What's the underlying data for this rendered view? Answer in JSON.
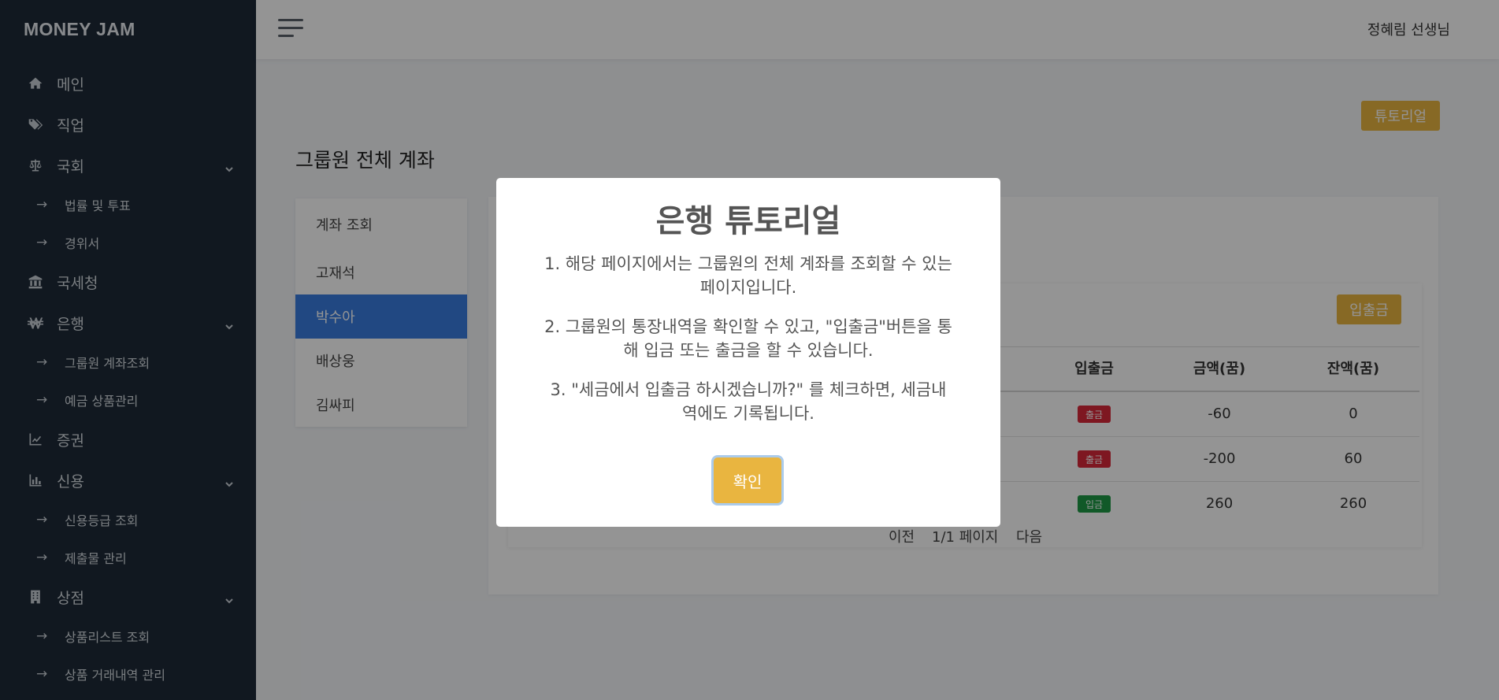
{
  "brand": "MONEY JAM",
  "user": {
    "name": "정혜림 선생님"
  },
  "sidebar": {
    "main": "메인",
    "job": "직업",
    "assembly": "국회",
    "law_vote": "법률 및 투표",
    "statement": "경위서",
    "tax": "국세청",
    "bank": "은행",
    "group_accounts": "그룹원 계좌조회",
    "deposit_products": "예금 상품관리",
    "securities": "증권",
    "credit": "신용",
    "credit_rating": "신용등급 조회",
    "submission": "제출물 관리",
    "store": "상점",
    "product_list": "상품리스트 조회",
    "product_history": "상품 거래내역 관리",
    "arrow": "→"
  },
  "main": {
    "tutorial_button": "튜토리얼",
    "page_title": "그룹원 전체 계좌",
    "members": [
      "계좌 조회",
      "고재석",
      "박수아",
      "배상웅",
      "김싸피"
    ],
    "io_button": "입출금",
    "table": {
      "headers": [
        "입출금",
        "금액(꿈)",
        "잔액(꿈)"
      ],
      "rows": [
        {
          "type": "출금",
          "amount": "-60",
          "balance": "0"
        },
        {
          "type": "출금",
          "amount": "-200",
          "balance": "60"
        },
        {
          "type": "입금",
          "amount": "260",
          "balance": "260"
        }
      ]
    },
    "pager": {
      "prev": "이전",
      "page": "1/1 페이지",
      "next": "다음"
    }
  },
  "modal": {
    "title": "은행 튜토리얼",
    "line1": "1. 해당 페이지에서는 그룹원의 전체 계좌를 조회할 수 있는 페이지입니다.",
    "line2": "2. 그룹원의 통장내역을 확인할 수 있고, \"입출금\"버튼을 통해 입금 또는 출금을 할 수 있습니다.",
    "line3": "3. \"세금에서 입출금 하시겠습니까?\" 를 체크하면, 세금내역에도 기록됩니다.",
    "confirm": "확인"
  },
  "colors": {
    "sidebar_bg": "#1e2a38",
    "accent": "#e9b540",
    "active": "#3a7de0",
    "withdraw": "#d9283a",
    "deposit": "#1e9a45"
  }
}
